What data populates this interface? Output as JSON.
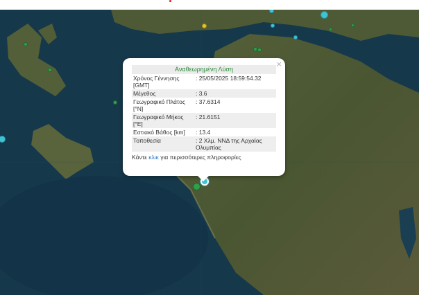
{
  "popup": {
    "header": "Αναθεωρημένη Λύση",
    "close_label": "×",
    "rows": [
      {
        "label": "Χρόνος Γέννησης [GMT]",
        "value": ": 25/05/2025 18:59:54.32"
      },
      {
        "label": "Μέγεθος",
        "value": ": 3.6"
      },
      {
        "label": "Γεωγραφικό Πλάτος [°N]",
        "value": ": 37.6314"
      },
      {
        "label": "Γεωγραφικό Μήκος [°E]",
        "value": ": 21.6151"
      },
      {
        "label": "Εστιακό Βάθος [km]",
        "value": ": 13.4"
      },
      {
        "label": "Τοποθεσία",
        "value": ": 2 Χλμ. ΝΝΔ της Αρχαίας Ολυμπίας"
      }
    ],
    "footer_before": "Κάντε ",
    "footer_link": "κλικ",
    "footer_after": " για περισσότερες πληροφορίες"
  },
  "colors": {
    "sea": "#16384b",
    "land": "#4d5a35",
    "cyan_marker": "#3fc3d4",
    "green_marker": "#2fa04a",
    "yellow_marker": "#e6c22a",
    "header_text": "#2e8b3a",
    "link": "#2a78c2"
  }
}
